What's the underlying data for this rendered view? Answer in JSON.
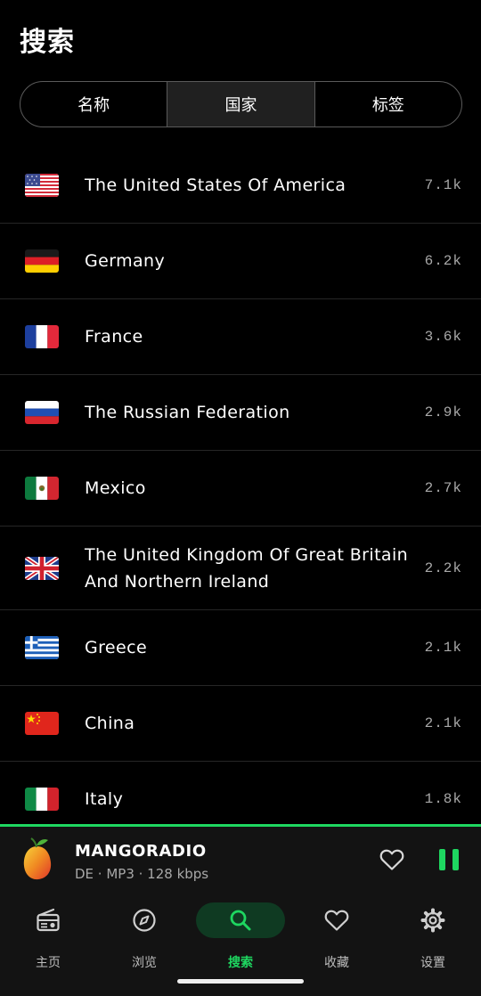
{
  "header": {
    "title": "搜索"
  },
  "tabs": [
    {
      "label": "名称",
      "active": false
    },
    {
      "label": "国家",
      "active": true
    },
    {
      "label": "标签",
      "active": false
    }
  ],
  "countries": [
    {
      "name": "The United States Of America",
      "count": "7.1k",
      "flag": "us-flag"
    },
    {
      "name": "Germany",
      "count": "6.2k",
      "flag": "de-flag"
    },
    {
      "name": "France",
      "count": "3.6k",
      "flag": "fr-flag"
    },
    {
      "name": "The Russian Federation",
      "count": "2.9k",
      "flag": "ru-flag"
    },
    {
      "name": "Mexico",
      "count": "2.7k",
      "flag": "mx-flag"
    },
    {
      "name": "The United Kingdom Of Great Britain And Northern Ireland",
      "count": "2.2k",
      "flag": "gb-flag"
    },
    {
      "name": "Greece",
      "count": "2.1k",
      "flag": "gr-flag"
    },
    {
      "name": "China",
      "count": "2.1k",
      "flag": "cn-flag"
    },
    {
      "name": "Italy",
      "count": "1.8k",
      "flag": "it-flag"
    }
  ],
  "player": {
    "station": "MANGORADIO",
    "meta": "DE · MP3 · 128 kbps",
    "art_icon": "mango-icon",
    "accent": "#1ed760"
  },
  "nav": [
    {
      "label": "主页",
      "icon": "radio-icon",
      "active": false
    },
    {
      "label": "浏览",
      "icon": "compass-icon",
      "active": false
    },
    {
      "label": "搜索",
      "icon": "search-icon",
      "active": true
    },
    {
      "label": "收藏",
      "icon": "heart-icon",
      "active": false
    },
    {
      "label": "设置",
      "icon": "gear-icon",
      "active": false
    }
  ]
}
